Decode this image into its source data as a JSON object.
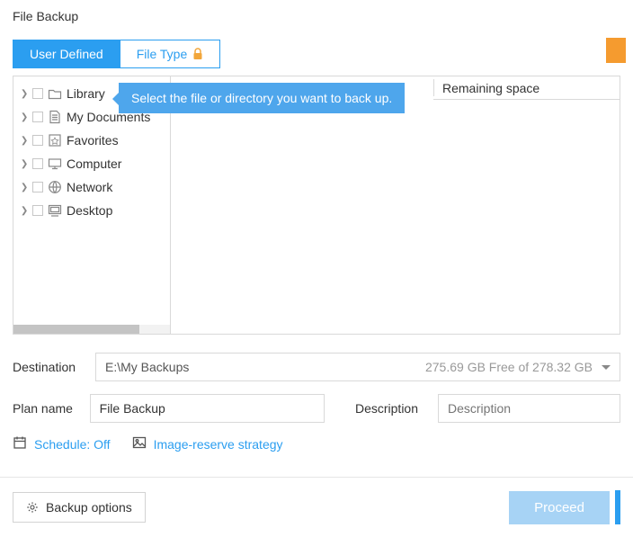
{
  "window": {
    "title": "File Backup"
  },
  "tabs": {
    "user_defined": "User Defined",
    "file_type": "File Type"
  },
  "tooltip": "Select the file or directory you want to back up.",
  "tree": {
    "items": [
      {
        "label": "Library",
        "icon": "folder"
      },
      {
        "label": "My Documents",
        "icon": "document"
      },
      {
        "label": "Favorites",
        "icon": "favorites"
      },
      {
        "label": "Computer",
        "icon": "computer"
      },
      {
        "label": "Network",
        "icon": "network"
      },
      {
        "label": "Desktop",
        "icon": "desktop"
      }
    ]
  },
  "columns": {
    "remaining_space": "Remaining space"
  },
  "form": {
    "destination_label": "Destination",
    "destination_value": "E:\\My Backups",
    "free_space": "275.69 GB Free of 278.32 GB",
    "plan_label": "Plan name",
    "plan_value": "File Backup",
    "description_label": "Description",
    "description_placeholder": "Description"
  },
  "links": {
    "schedule": "Schedule: Off",
    "strategy": "Image-reserve strategy"
  },
  "footer": {
    "options": "Backup options",
    "proceed": "Proceed"
  }
}
